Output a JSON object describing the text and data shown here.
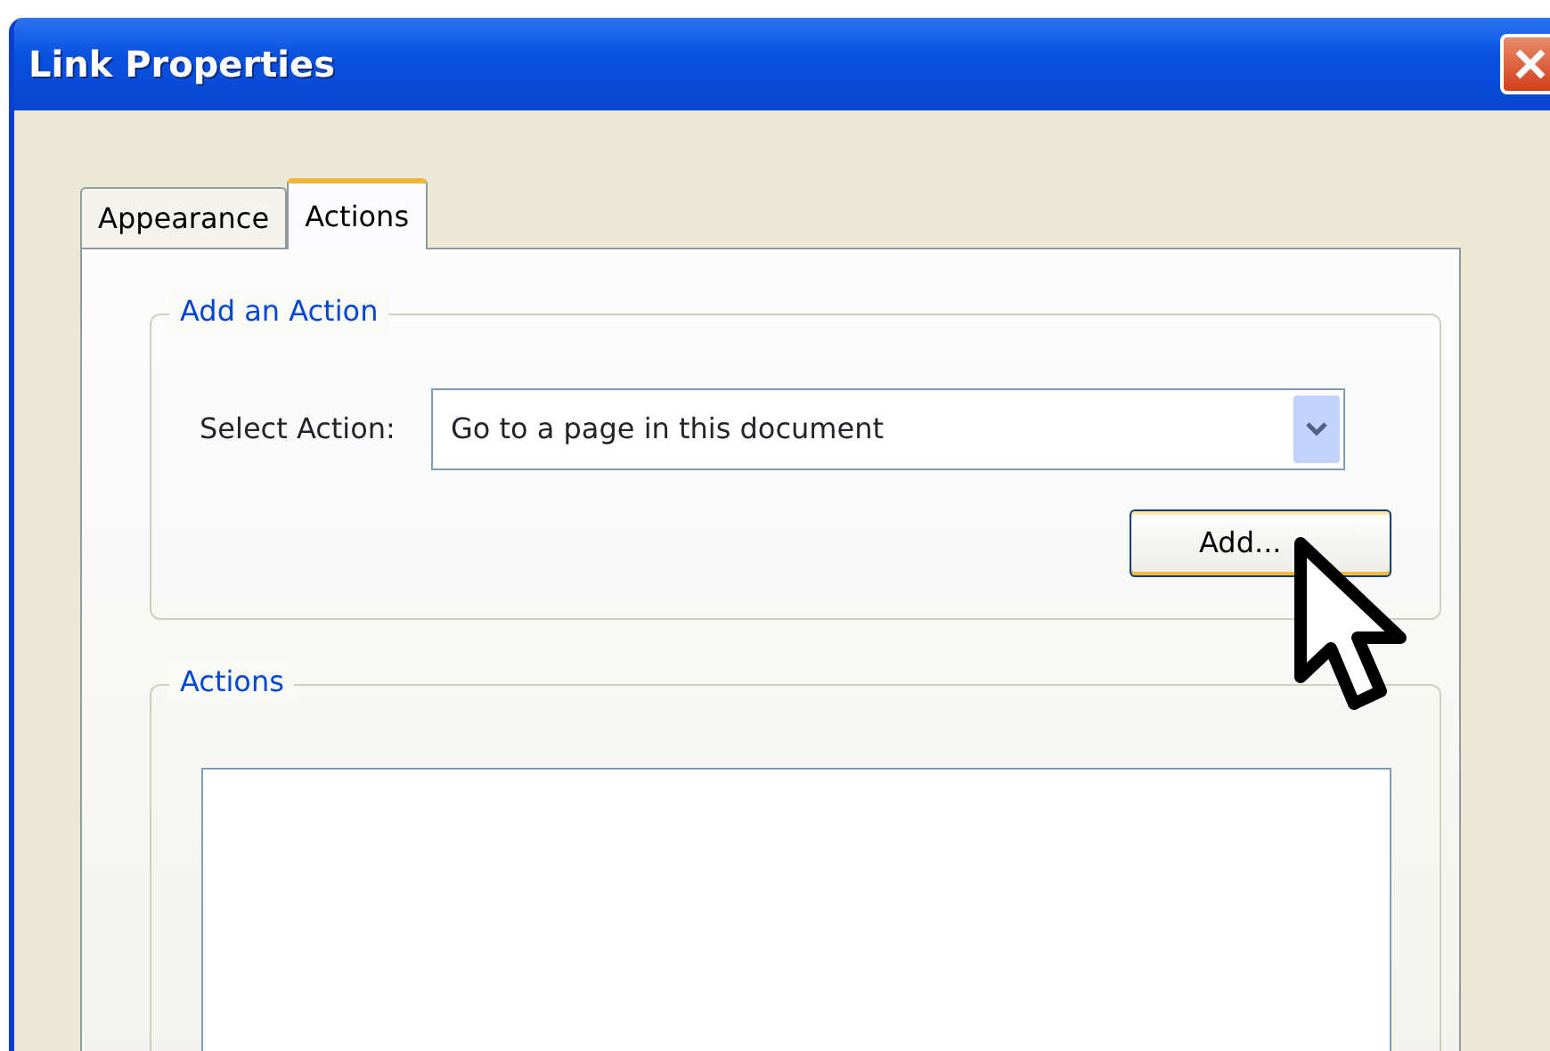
{
  "window": {
    "title": "Link Properties"
  },
  "tabs": [
    {
      "label": "Appearance",
      "selected": false
    },
    {
      "label": "Actions",
      "selected": true
    }
  ],
  "add_action": {
    "title": "Add an Action",
    "select_label": "Select Action:",
    "select_value": "Go to a page in this document",
    "add_button": "Add..."
  },
  "actions": {
    "title": "Actions"
  }
}
